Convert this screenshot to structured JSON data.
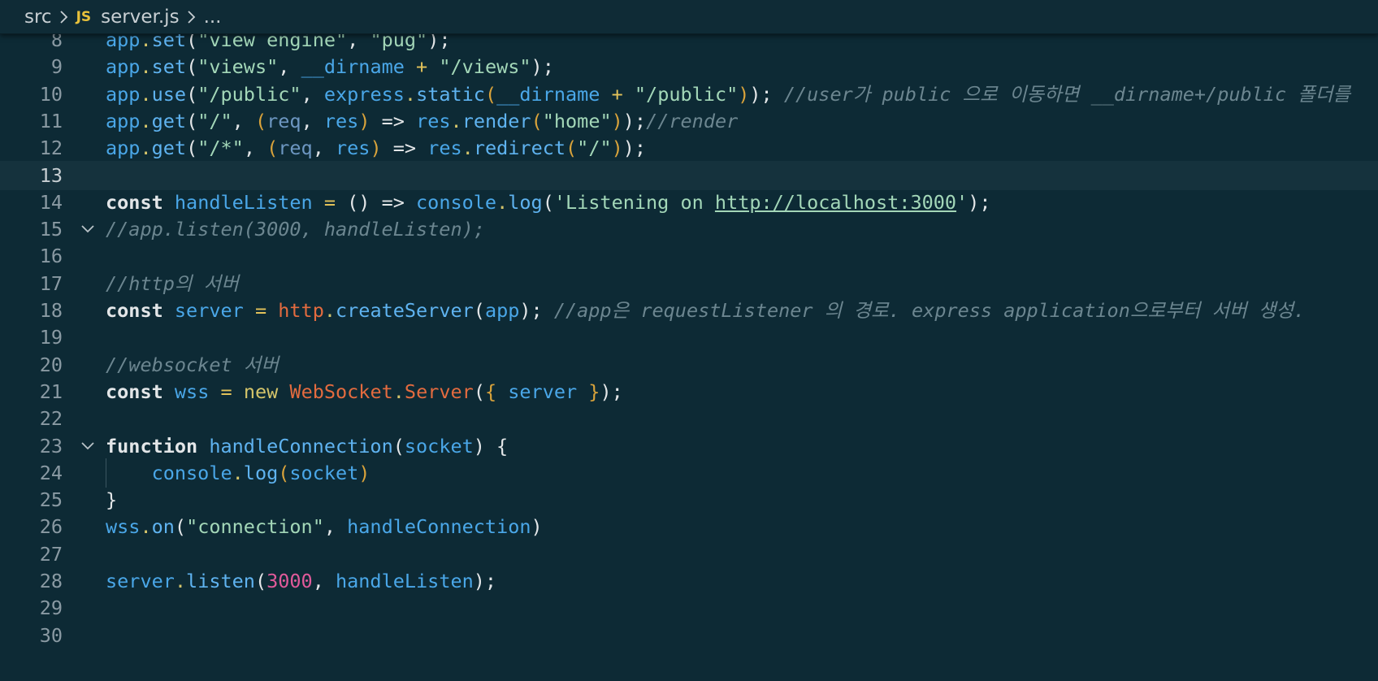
{
  "breadcrumb": {
    "folder": "src",
    "file_icon": "JS",
    "file": "server.js",
    "trail": "..."
  },
  "editor": {
    "current_line": 13,
    "folded_lines": [
      15,
      23
    ],
    "colors": {
      "background": "#0d2a35",
      "current_line": "#15323d",
      "keyword": "#e3e6e8",
      "identifier": "#4aa7e8",
      "string": "#a3d7b8",
      "comment": "#6c8690",
      "number": "#e05a9a",
      "class": "#e36b3f"
    },
    "lines": [
      {
        "n": "8",
        "tokens": [
          [
            "obj",
            "app"
          ],
          [
            "dot",
            "."
          ],
          [
            "fn",
            "set"
          ],
          [
            "p",
            "("
          ],
          [
            "str",
            "\"view engine\""
          ],
          [
            "p",
            ", "
          ],
          [
            "str",
            "\"pug\""
          ],
          [
            "p",
            ");"
          ]
        ]
      },
      {
        "n": "9",
        "tokens": [
          [
            "obj",
            "app"
          ],
          [
            "dot",
            "."
          ],
          [
            "fn",
            "set"
          ],
          [
            "p",
            "("
          ],
          [
            "str",
            "\"views\""
          ],
          [
            "p",
            ", "
          ],
          [
            "var",
            "__dirname"
          ],
          [
            "op",
            " + "
          ],
          [
            "str",
            "\"/views\""
          ],
          [
            "p",
            ");"
          ]
        ]
      },
      {
        "n": "10",
        "tokens": [
          [
            "obj",
            "app"
          ],
          [
            "dot",
            "."
          ],
          [
            "fn",
            "use"
          ],
          [
            "p",
            "("
          ],
          [
            "str",
            "\"/public\""
          ],
          [
            "p",
            ", "
          ],
          [
            "obj",
            "express"
          ],
          [
            "dot",
            "."
          ],
          [
            "fn",
            "static"
          ],
          [
            "br2",
            "("
          ],
          [
            "var",
            "__dirname"
          ],
          [
            "op",
            " + "
          ],
          [
            "str",
            "\"/public\""
          ],
          [
            "br2",
            ")"
          ],
          [
            "p",
            "); "
          ],
          [
            "cm",
            "//user가 public 으로 이동하면 __dirname+/public 폴더를"
          ]
        ]
      },
      {
        "n": "11",
        "tokens": [
          [
            "obj",
            "app"
          ],
          [
            "dot",
            "."
          ],
          [
            "fn",
            "get"
          ],
          [
            "p",
            "("
          ],
          [
            "str",
            "\"/\""
          ],
          [
            "p",
            ", "
          ],
          [
            "br2",
            "("
          ],
          [
            "par",
            "req"
          ],
          [
            "p",
            ", "
          ],
          [
            "var",
            "res"
          ],
          [
            "br2",
            ")"
          ],
          [
            "p",
            " => "
          ],
          [
            "obj",
            "res"
          ],
          [
            "dot",
            "."
          ],
          [
            "fn",
            "render"
          ],
          [
            "br2",
            "("
          ],
          [
            "str",
            "\"home\""
          ],
          [
            "br2",
            ")"
          ],
          [
            "p",
            ");"
          ],
          [
            "cm",
            "//render"
          ]
        ]
      },
      {
        "n": "12",
        "tokens": [
          [
            "obj",
            "app"
          ],
          [
            "dot",
            "."
          ],
          [
            "fn",
            "get"
          ],
          [
            "p",
            "("
          ],
          [
            "str",
            "\"/*\""
          ],
          [
            "p",
            ", "
          ],
          [
            "br2",
            "("
          ],
          [
            "par",
            "req"
          ],
          [
            "p",
            ", "
          ],
          [
            "var",
            "res"
          ],
          [
            "br2",
            ")"
          ],
          [
            "p",
            " => "
          ],
          [
            "obj",
            "res"
          ],
          [
            "dot",
            "."
          ],
          [
            "fn",
            "redirect"
          ],
          [
            "br2",
            "("
          ],
          [
            "str",
            "\"/\""
          ],
          [
            "br2",
            ")"
          ],
          [
            "p",
            ");"
          ]
        ]
      },
      {
        "n": "13",
        "tokens": []
      },
      {
        "n": "14",
        "tokens": [
          [
            "kw",
            "const"
          ],
          [
            "p",
            " "
          ],
          [
            "var",
            "handleListen"
          ],
          [
            "op",
            " = "
          ],
          [
            "p",
            "() => "
          ],
          [
            "obj",
            "console"
          ],
          [
            "dot",
            "."
          ],
          [
            "fn",
            "log"
          ],
          [
            "p",
            "("
          ],
          [
            "str",
            "'Listening on "
          ],
          [
            "url",
            "http://localhost:3000"
          ],
          [
            "str",
            "'"
          ],
          [
            "p",
            ");"
          ]
        ]
      },
      {
        "n": "15",
        "tokens": [
          [
            "cm",
            "//app.listen(3000, handleListen);"
          ]
        ]
      },
      {
        "n": "16",
        "tokens": []
      },
      {
        "n": "17",
        "tokens": [
          [
            "cm",
            "//http의 서버"
          ]
        ]
      },
      {
        "n": "18",
        "tokens": [
          [
            "kw",
            "const"
          ],
          [
            "p",
            " "
          ],
          [
            "var",
            "server"
          ],
          [
            "op",
            " = "
          ],
          [
            "cls",
            "http"
          ],
          [
            "dot",
            "."
          ],
          [
            "fn",
            "createServer"
          ],
          [
            "p",
            "("
          ],
          [
            "var",
            "app"
          ],
          [
            "p",
            "); "
          ],
          [
            "cm",
            "//app은 requestListener 의 경로. express application으로부터 서버 생성."
          ]
        ]
      },
      {
        "n": "19",
        "tokens": []
      },
      {
        "n": "20",
        "tokens": [
          [
            "cm",
            "//websocket 서버"
          ]
        ]
      },
      {
        "n": "21",
        "tokens": [
          [
            "kw",
            "const"
          ],
          [
            "p",
            " "
          ],
          [
            "var",
            "wss"
          ],
          [
            "op",
            " = "
          ],
          [
            "dot",
            "new"
          ],
          [
            "p",
            " "
          ],
          [
            "cls",
            "WebSocket"
          ],
          [
            "dot",
            "."
          ],
          [
            "cls",
            "Server"
          ],
          [
            "p",
            "("
          ],
          [
            "br2",
            "{ "
          ],
          [
            "var",
            "server"
          ],
          [
            "br2",
            " }"
          ],
          [
            "p",
            ");"
          ]
        ]
      },
      {
        "n": "22",
        "tokens": []
      },
      {
        "n": "23",
        "tokens": [
          [
            "kw",
            "function"
          ],
          [
            "p",
            " "
          ],
          [
            "fn",
            "handleConnection"
          ],
          [
            "p",
            "("
          ],
          [
            "var",
            "socket"
          ],
          [
            "p",
            ") {"
          ]
        ]
      },
      {
        "n": "24",
        "tokens": [
          [
            "p",
            "    "
          ],
          [
            "obj",
            "console"
          ],
          [
            "dot",
            "."
          ],
          [
            "fn",
            "log"
          ],
          [
            "br2",
            "("
          ],
          [
            "var",
            "socket"
          ],
          [
            "br2",
            ")"
          ]
        ]
      },
      {
        "n": "25",
        "tokens": [
          [
            "p",
            "}"
          ]
        ]
      },
      {
        "n": "26",
        "tokens": [
          [
            "obj",
            "wss"
          ],
          [
            "dot",
            "."
          ],
          [
            "fn",
            "on"
          ],
          [
            "p",
            "("
          ],
          [
            "str",
            "\"connection\""
          ],
          [
            "p",
            ", "
          ],
          [
            "var",
            "handleConnection"
          ],
          [
            "p",
            ")"
          ]
        ]
      },
      {
        "n": "27",
        "tokens": []
      },
      {
        "n": "28",
        "tokens": [
          [
            "obj",
            "server"
          ],
          [
            "dot",
            "."
          ],
          [
            "fn",
            "listen"
          ],
          [
            "p",
            "("
          ],
          [
            "num",
            "3000"
          ],
          [
            "p",
            ", "
          ],
          [
            "var",
            "handleListen"
          ],
          [
            "p",
            ");"
          ]
        ]
      },
      {
        "n": "29",
        "tokens": []
      },
      {
        "n": "30",
        "tokens": []
      }
    ]
  }
}
